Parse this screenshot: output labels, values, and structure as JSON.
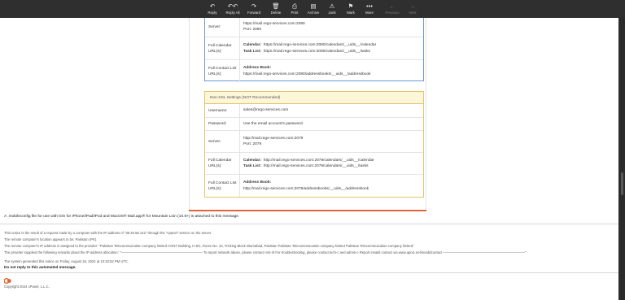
{
  "toolbar": {
    "buttons": [
      {
        "label": "Reply",
        "icon": "↶"
      },
      {
        "label": "Reply All",
        "icon": "↶↶"
      },
      {
        "label": "Forward",
        "icon": "↷"
      },
      {
        "label": "Delete",
        "icon": "🗑"
      },
      {
        "label": "Print",
        "icon": "⎙"
      },
      {
        "label": "Archive",
        "icon": "▤"
      },
      {
        "label": "Junk",
        "icon": "⚠"
      },
      {
        "label": "Mark",
        "icon": "⚑"
      },
      {
        "label": "More",
        "icon": "•••"
      },
      {
        "label": "Previous",
        "icon": "←"
      },
      {
        "label": "Next",
        "icon": "→"
      }
    ]
  },
  "ssl_box": {
    "server_label": "Server:",
    "server_value": "https://mail.rego-services.com:2080",
    "server_port": "Port: 2080",
    "calendar_label": "Full Calendar URL(s):",
    "calendar_key": "Calendar:",
    "calendar_value": "https://mail.rego-services.com:2080/calendars/__uids__/calendar",
    "task_key": "Task List:",
    "task_value": "https://mail.rego-services.com:2080/calendars/__uids__/tasks",
    "contact_label": "Full Contact List URL(s):",
    "address_key": "Address Book:",
    "address_value": "https://mail.rego-services.com:2080/addressbooks/__uids__/addressbook"
  },
  "nonssl_box": {
    "header": "Non-SSL Settings (NOT Recommended)",
    "username_label": "Username:",
    "username_value": "sales@rego-services.com",
    "password_label": "Password:",
    "password_value": "Use the email account's password.",
    "server_label": "Server:",
    "server_value": "http://mail.rego-services.com:2079",
    "server_port": "Port: 2079",
    "calendar_label": "Full Calendar URL(s):",
    "calendar_key": "Calendar:",
    "calendar_value": "http://mail.rego-services.com:2079/calendars/__uids__/calendar",
    "task_key": "Task List:",
    "task_value": "http://mail.rego-services.com:2079/calendars/__uids__/tasks",
    "contact_label": "Full Contact List URL(s):",
    "address_key": "Address Book:",
    "address_value": "http://mail.rego-services.com:2079/addressbooks/__uids__/addressbook"
  },
  "attachment_note": "A .mobileconfig file for use with iOS for iPhone/iPad/iPod and MacOS® Mail.app® for Mountain Lion (10.8+) is attached to this message.",
  "footer": {
    "line1": "This notice is the result of a request made by a computer with the IP address of \"39.40.58.142\" through the \"cpanel\" service on the server.",
    "line2": "The remote computer's location appears to be: Pakistan (PK).",
    "line3": "The remote computer's IP address is assigned to the provider: \"Pakistan Telecommuication company limited CGNT Building, H-8/1, Room No. 10, Tricking Block Islamabad, Pakistan Pakistan Telecommuication company limited Pakistan Telecommuication company limited\"",
    "line4": "The provider supplied the following remarks about the IP address allocation: \"———————————————————————— To report network abuse, please contact mnt-irt For troubleshooting, please contact tech-c and admin-c Report invalid contact via www.apnic.net/invalidcontact ————————————————————————\"",
    "line5": "The system generated this notice on Friday, August 16, 2024 at 10:33:52 PM UTC.",
    "line6": "Do not reply to this automated message.",
    "copyright": "Copyright 2024 cPanel, L.L.C."
  },
  "colors": {
    "accent_orange": "#e0663a",
    "ssl_border": "#6b9bd1",
    "nonssl_border": "#e6c46a",
    "nonssl_header_bg": "#fdf6d8"
  }
}
